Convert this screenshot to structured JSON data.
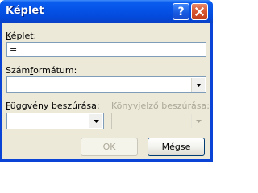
{
  "window": {
    "title": "Képlet"
  },
  "titlebar_buttons": {
    "help": "?",
    "close_icon": "close-x-icon"
  },
  "formula": {
    "label_accel": "K",
    "label_rest": "éplet:",
    "value": "="
  },
  "number_format": {
    "label_pre": "Szám",
    "label_accel": "f",
    "label_rest": "ormátum:",
    "value": ""
  },
  "paste_function": {
    "label_accel": "F",
    "label_rest": "üggvény beszúrása:",
    "value": ""
  },
  "paste_bookmark": {
    "label": "Könyvjelző beszúrása:",
    "value": ""
  },
  "buttons": {
    "ok": "OK",
    "cancel": "Mégse"
  },
  "colors": {
    "titlebar": "#0552e6",
    "close": "#d6542e",
    "client": "#ece9d8",
    "disabled_text": "#aca899"
  }
}
